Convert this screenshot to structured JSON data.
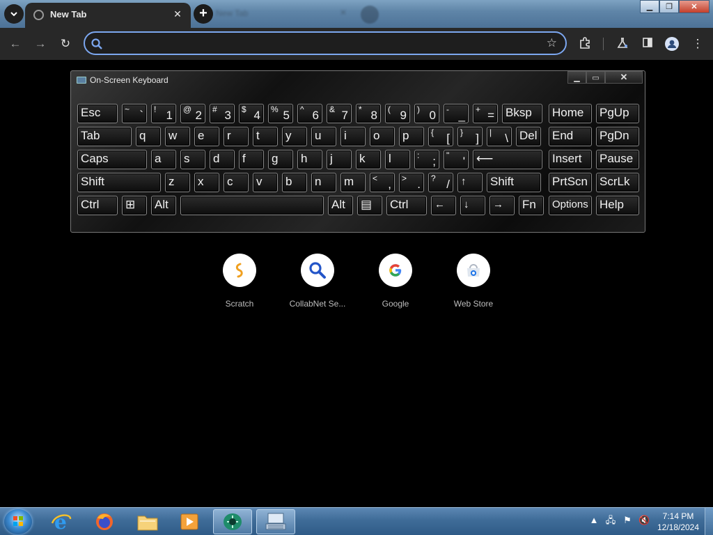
{
  "browser": {
    "active_tab_title": "New Tab",
    "inactive_tab_title": "New Tab",
    "address_value": "",
    "address_placeholder": ""
  },
  "osk": {
    "title": "On-Screen Keyboard",
    "rows": [
      [
        {
          "label": "Esc",
          "w": 58
        },
        {
          "shift": "~",
          "main": "`",
          "w": 36
        },
        {
          "shift": "!",
          "main": "1",
          "w": 36
        },
        {
          "shift": "@",
          "main": "2",
          "w": 36
        },
        {
          "shift": "#",
          "main": "3",
          "w": 36
        },
        {
          "shift": "$",
          "main": "4",
          "w": 36
        },
        {
          "shift": "%",
          "main": "5",
          "w": 36
        },
        {
          "shift": "^",
          "main": "6",
          "w": 36
        },
        {
          "shift": "&",
          "main": "7",
          "w": 36
        },
        {
          "shift": "*",
          "main": "8",
          "w": 36
        },
        {
          "shift": "(",
          "main": "9",
          "w": 36
        },
        {
          "shift": ")",
          "main": "0",
          "w": 36
        },
        {
          "shift": "-",
          "main": "_",
          "w": 36
        },
        {
          "shift": "+",
          "main": "=",
          "w": 36
        },
        {
          "label": "Bksp",
          "w": 58
        }
      ],
      [
        {
          "label": "Tab",
          "w": 78
        },
        {
          "label": "q",
          "w": 36
        },
        {
          "label": "w",
          "w": 36
        },
        {
          "label": "e",
          "w": 36
        },
        {
          "label": "r",
          "w": 36
        },
        {
          "label": "t",
          "w": 36
        },
        {
          "label": "y",
          "w": 36
        },
        {
          "label": "u",
          "w": 36
        },
        {
          "label": "i",
          "w": 36
        },
        {
          "label": "o",
          "w": 36
        },
        {
          "label": "p",
          "w": 36
        },
        {
          "shift": "{",
          "main": "[",
          "w": 36
        },
        {
          "shift": "}",
          "main": "]",
          "w": 36
        },
        {
          "shift": "|",
          "main": "\\",
          "w": 36
        },
        {
          "label": "Del",
          "w": 36
        }
      ],
      [
        {
          "label": "Caps",
          "w": 100
        },
        {
          "label": "a",
          "w": 36
        },
        {
          "label": "s",
          "w": 36
        },
        {
          "label": "d",
          "w": 36
        },
        {
          "label": "f",
          "w": 36
        },
        {
          "label": "g",
          "w": 36
        },
        {
          "label": "h",
          "w": 36
        },
        {
          "label": "j",
          "w": 36
        },
        {
          "label": "k",
          "w": 36
        },
        {
          "label": "l",
          "w": 36
        },
        {
          "shift": ":",
          "main": ";",
          "w": 36
        },
        {
          "shift": "\"",
          "main": "'",
          "w": 36
        },
        {
          "label": "⟵",
          "w": 100
        }
      ],
      [
        {
          "label": "Shift",
          "w": 120
        },
        {
          "label": "z",
          "w": 36
        },
        {
          "label": "x",
          "w": 36
        },
        {
          "label": "c",
          "w": 36
        },
        {
          "label": "v",
          "w": 36
        },
        {
          "label": "b",
          "w": 36
        },
        {
          "label": "n",
          "w": 36
        },
        {
          "label": "m",
          "w": 36
        },
        {
          "shift": "<",
          "main": ",",
          "w": 36
        },
        {
          "shift": ">",
          "main": ".",
          "w": 36
        },
        {
          "shift": "?",
          "main": "/",
          "w": 36
        },
        {
          "label": "↑",
          "w": 36,
          "small": true
        },
        {
          "label": "Shift",
          "w": 78
        }
      ],
      [
        {
          "label": "Ctrl",
          "w": 58
        },
        {
          "label": "⊞",
          "w": 36
        },
        {
          "label": "Alt",
          "w": 36
        },
        {
          "label": "",
          "w": 206
        },
        {
          "label": "Alt",
          "w": 36
        },
        {
          "label": "▤",
          "w": 36
        },
        {
          "label": "Ctrl",
          "w": 58
        },
        {
          "label": "←",
          "w": 36,
          "small": true
        },
        {
          "label": "↓",
          "w": 36,
          "small": true
        },
        {
          "label": "→",
          "w": 36,
          "small": true
        },
        {
          "label": "Fn",
          "w": 36
        }
      ]
    ],
    "nav_rows": [
      [
        {
          "label": "Home"
        },
        {
          "label": "PgUp"
        }
      ],
      [
        {
          "label": "End"
        },
        {
          "label": "PgDn"
        }
      ],
      [
        {
          "label": "Insert"
        },
        {
          "label": "Pause"
        }
      ],
      [
        {
          "label": "PrtScn"
        },
        {
          "label": "ScrLk"
        }
      ],
      [
        {
          "label": "Options"
        },
        {
          "label": "Help"
        }
      ]
    ]
  },
  "shortcuts": [
    {
      "label": "Scratch",
      "icon": "scratch-icon"
    },
    {
      "label": "CollabNet Se...",
      "icon": "magnifier-icon"
    },
    {
      "label": "Google",
      "icon": "google-icon"
    },
    {
      "label": "Web Store",
      "icon": "web-store-icon"
    }
  ],
  "taskbar": {
    "time": "7:14 PM",
    "date": "12/18/2024"
  },
  "colors": {
    "accent": "#7ca7f0",
    "taskbar": "#3f6c98"
  }
}
